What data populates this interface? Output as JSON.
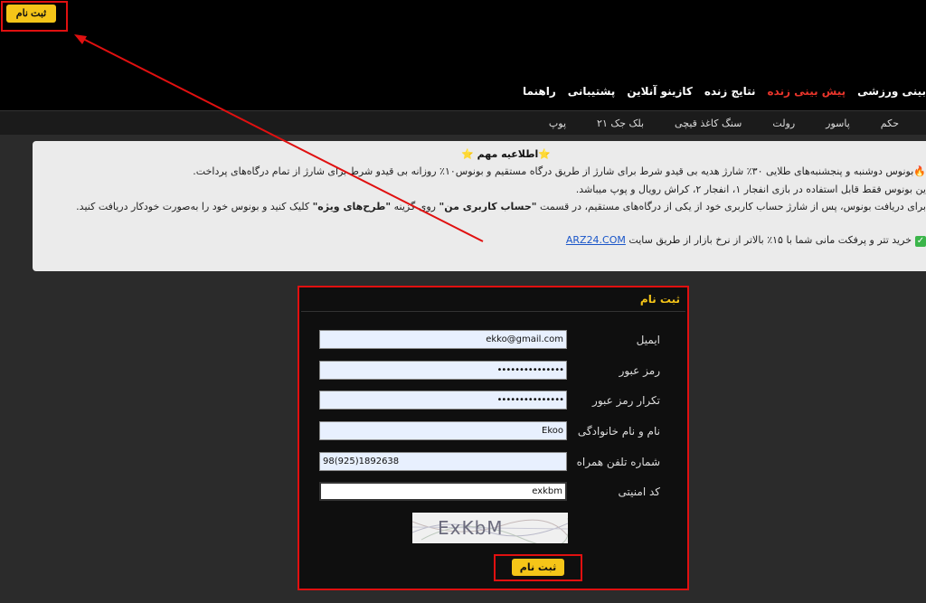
{
  "header": {
    "signup_button": "ثبت نام",
    "nav": [
      {
        "label": "بینی ورزشی",
        "active": false
      },
      {
        "label": "پیش بینی زنده",
        "active": true
      },
      {
        "label": "نتایج زنده",
        "active": false
      },
      {
        "label": "کازینو آنلاین",
        "active": false
      },
      {
        "label": "پشتیبانی",
        "active": false
      },
      {
        "label": "راهنما",
        "active": false
      }
    ],
    "subnav": [
      "حکم",
      "پاسور",
      "رولت",
      "سنگ کاغذ قیچی",
      "بلک جک ۲۱",
      "پوپ"
    ]
  },
  "notice": {
    "title": "⭐اطلاعیه مهم ⭐",
    "line1": "🔥بونوس دوشنبه و پنجشنبه‌های طلایی ۳۰٪ شارژ هدیه بی قیدو شرط برای شارژ از طریق درگاه مستقیم و بونوس۱۰٪ روزانه بی قیدو شرط برای شارژ از تمام درگاه‌های پرداخت.",
    "line2": "ین بونوس فقط قابل استفاده در بازی انفجار ۱، انفجار ۲، کراش رویال و پوپ میباشد.",
    "line3_a": "برای دریافت بونوس، پس از شارژ حساب کاربری خود از یکی از درگاه‌های مستقیم، در قسمت ",
    "line3_b": "\"حساب کاربری من\"",
    "line3_c": " روی گزینه ",
    "line3_d": "\"طرح‌های ویژه\"",
    "line3_e": " کلیک کنید و بونوس خود را به‌صورت خودکار دریافت کنید.",
    "line4_text": "خرید تتر و پرفکت مانی شما با ۱۵٪ بالاتر از نرخ بازار از طریق سایت ",
    "line4_link": "ARZ24.COM"
  },
  "form": {
    "title": "ثبت نام",
    "fields": {
      "email": {
        "label": "ایمیل",
        "value": "ekko@gmail.com"
      },
      "password": {
        "label": "رمز عبور",
        "value": "•••••••••••••••"
      },
      "password_repeat": {
        "label": "تکرار رمز عبور",
        "value": "•••••••••••••••"
      },
      "full_name": {
        "label": "نام و نام خانوادگی",
        "value": "Ekoo"
      },
      "phone": {
        "label": "شماره تلفن همراه",
        "value": "98(925)1892638"
      },
      "captcha": {
        "label": "کد امنیتی",
        "value": "exkbm"
      }
    },
    "captcha_image_text": "ExKbM",
    "submit_label": "ثبت نام"
  },
  "colors": {
    "accent": "#f5c518",
    "highlight": "#e01010",
    "active_nav": "#e8352b"
  }
}
